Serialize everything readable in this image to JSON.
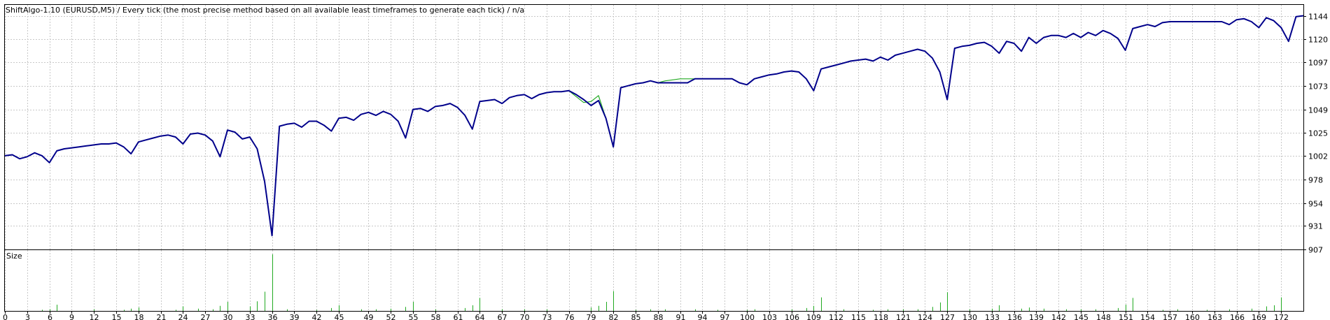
{
  "report_title": "ShiftAlgo-1.10 (EURUSD,M5) / Every tick (the most precise method based on all available least timeframes to generate each tick) / n/a",
  "volume_panel_label": "Size",
  "colors": {
    "balance_line": "#00008b",
    "equity_line": "#22aa22",
    "volume_bars": "#22aa22",
    "grid": "#c8c8c8",
    "frame": "#000000"
  },
  "chart_data": {
    "type": "line",
    "title": "ShiftAlgo-1.10 (EURUSD,M5) / Every tick (the most precise method based on all available least timeframes to generate each tick) / n/a",
    "xlabel": "",
    "ylabel": "",
    "xlim": [
      0,
      175
    ],
    "ylim": [
      907,
      1155
    ],
    "x_ticks": [
      0,
      3,
      6,
      9,
      12,
      15,
      18,
      21,
      24,
      27,
      30,
      33,
      36,
      39,
      42,
      45,
      49,
      52,
      55,
      58,
      61,
      64,
      67,
      70,
      73,
      76,
      79,
      82,
      85,
      88,
      91,
      94,
      97,
      100,
      103,
      106,
      109,
      112,
      115,
      118,
      121,
      124,
      127,
      130,
      133,
      136,
      139,
      142,
      145,
      148,
      151,
      154,
      157,
      160,
      163,
      166,
      169,
      172
    ],
    "y_ticks": [
      907,
      931,
      954,
      978,
      1002,
      1025,
      1049,
      1073,
      1097,
      1120,
      1144
    ],
    "grid": true,
    "series": [
      {
        "name": "",
        "color": "#00008b",
        "points": [
          [
            0,
            1002
          ],
          [
            1,
            1003
          ],
          [
            2,
            999
          ],
          [
            3,
            1001
          ],
          [
            4,
            1005
          ],
          [
            5,
            1002
          ],
          [
            6,
            995
          ],
          [
            7,
            1007
          ],
          [
            8,
            1009
          ],
          [
            9,
            1010
          ],
          [
            10,
            1011
          ],
          [
            11,
            1012
          ],
          [
            12,
            1013
          ],
          [
            13,
            1014
          ],
          [
            14,
            1014
          ],
          [
            15,
            1015
          ],
          [
            16,
            1011
          ],
          [
            17,
            1004
          ],
          [
            18,
            1016
          ],
          [
            19,
            1018
          ],
          [
            20,
            1020
          ],
          [
            21,
            1022
          ],
          [
            22,
            1023
          ],
          [
            23,
            1021
          ],
          [
            24,
            1014
          ],
          [
            25,
            1024
          ],
          [
            26,
            1025
          ],
          [
            27,
            1023
          ],
          [
            28,
            1017
          ],
          [
            29,
            1001
          ],
          [
            30,
            1028
          ],
          [
            31,
            1026
          ],
          [
            32,
            1019
          ],
          [
            33,
            1021
          ],
          [
            34,
            1009
          ],
          [
            35,
            976
          ],
          [
            36,
            921
          ],
          [
            37,
            1032
          ],
          [
            38,
            1034
          ],
          [
            39,
            1035
          ],
          [
            40,
            1031
          ],
          [
            41,
            1037
          ],
          [
            42,
            1037
          ],
          [
            43,
            1033
          ],
          [
            44,
            1027
          ],
          [
            45,
            1040
          ],
          [
            46,
            1041
          ],
          [
            47,
            1038
          ],
          [
            48,
            1044
          ],
          [
            49,
            1046
          ],
          [
            50,
            1043
          ],
          [
            51,
            1047
          ],
          [
            52,
            1044
          ],
          [
            53,
            1037
          ],
          [
            54,
            1020
          ],
          [
            55,
            1049
          ],
          [
            56,
            1050
          ],
          [
            57,
            1047
          ],
          [
            58,
            1052
          ],
          [
            59,
            1053
          ],
          [
            60,
            1055
          ],
          [
            61,
            1051
          ],
          [
            62,
            1043
          ],
          [
            63,
            1029
          ],
          [
            64,
            1057
          ],
          [
            65,
            1058
          ],
          [
            66,
            1059
          ],
          [
            67,
            1055
          ],
          [
            68,
            1061
          ],
          [
            69,
            1063
          ],
          [
            70,
            1064
          ],
          [
            71,
            1060
          ],
          [
            72,
            1064
          ],
          [
            73,
            1066
          ],
          [
            74,
            1067
          ],
          [
            75,
            1067
          ],
          [
            76,
            1068
          ],
          [
            77,
            1064
          ],
          [
            78,
            1059
          ],
          [
            79,
            1053
          ],
          [
            80,
            1058
          ],
          [
            81,
            1040
          ],
          [
            82,
            1011
          ],
          [
            83,
            1071
          ],
          [
            84,
            1073
          ],
          [
            85,
            1075
          ],
          [
            86,
            1076
          ],
          [
            87,
            1078
          ],
          [
            88,
            1076
          ],
          [
            89,
            1076
          ],
          [
            90,
            1076
          ],
          [
            91,
            1076
          ],
          [
            92,
            1076
          ],
          [
            93,
            1080
          ],
          [
            94,
            1080
          ],
          [
            95,
            1080
          ],
          [
            96,
            1080
          ],
          [
            97,
            1080
          ],
          [
            98,
            1080
          ],
          [
            99,
            1076
          ],
          [
            100,
            1074
          ],
          [
            101,
            1080
          ],
          [
            102,
            1082
          ],
          [
            103,
            1084
          ],
          [
            104,
            1085
          ],
          [
            105,
            1087
          ],
          [
            106,
            1088
          ],
          [
            107,
            1087
          ],
          [
            108,
            1080
          ],
          [
            109,
            1068
          ],
          [
            110,
            1090
          ],
          [
            111,
            1092
          ],
          [
            112,
            1094
          ],
          [
            113,
            1096
          ],
          [
            114,
            1098
          ],
          [
            115,
            1099
          ],
          [
            116,
            1100
          ],
          [
            117,
            1098
          ],
          [
            118,
            1102
          ],
          [
            119,
            1099
          ],
          [
            120,
            1104
          ],
          [
            121,
            1106
          ],
          [
            122,
            1108
          ],
          [
            123,
            1110
          ],
          [
            124,
            1108
          ],
          [
            125,
            1101
          ],
          [
            126,
            1087
          ],
          [
            127,
            1059
          ],
          [
            128,
            1111
          ],
          [
            129,
            1113
          ],
          [
            130,
            1114
          ],
          [
            131,
            1116
          ],
          [
            132,
            1117
          ],
          [
            133,
            1113
          ],
          [
            134,
            1106
          ],
          [
            135,
            1118
          ],
          [
            136,
            1116
          ],
          [
            137,
            1108
          ],
          [
            138,
            1122
          ],
          [
            139,
            1116
          ],
          [
            140,
            1122
          ],
          [
            141,
            1124
          ],
          [
            142,
            1124
          ],
          [
            143,
            1122
          ],
          [
            144,
            1126
          ],
          [
            145,
            1122
          ],
          [
            146,
            1127
          ],
          [
            147,
            1124
          ],
          [
            148,
            1129
          ],
          [
            149,
            1126
          ],
          [
            150,
            1121
          ],
          [
            151,
            1109
          ],
          [
            152,
            1131
          ],
          [
            153,
            1133
          ],
          [
            154,
            1135
          ],
          [
            155,
            1133
          ],
          [
            156,
            1137
          ],
          [
            157,
            1138
          ],
          [
            158,
            1138
          ],
          [
            159,
            1138
          ],
          [
            160,
            1138
          ],
          [
            161,
            1138
          ],
          [
            162,
            1138
          ],
          [
            163,
            1138
          ],
          [
            164,
            1138
          ],
          [
            165,
            1135
          ],
          [
            166,
            1140
          ],
          [
            167,
            1141
          ],
          [
            168,
            1138
          ],
          [
            169,
            1132
          ],
          [
            170,
            1142
          ],
          [
            171,
            1139
          ],
          [
            172,
            1132
          ],
          [
            173,
            1118
          ],
          [
            174,
            1143
          ],
          [
            175,
            1144
          ]
        ]
      },
      {
        "name": "",
        "color": "#22aa22",
        "points": [
          [
            76,
            1068
          ],
          [
            77,
            1062
          ],
          [
            78,
            1056
          ],
          [
            79,
            1057
          ],
          [
            80,
            1063
          ],
          [
            81,
            1040
          ],
          [
            88,
            1076
          ],
          [
            89,
            1078
          ],
          [
            90,
            1079
          ],
          [
            91,
            1080
          ],
          [
            92,
            1080
          ],
          [
            93,
            1080
          ]
        ]
      }
    ],
    "volume": {
      "label": "Size",
      "color": "#22aa22",
      "ylim": [
        0,
        1
      ],
      "bars": [
        [
          5,
          0.02
        ],
        [
          6,
          0.03
        ],
        [
          7,
          0.11
        ],
        [
          12,
          0.03
        ],
        [
          16,
          0.02
        ],
        [
          17,
          0.04
        ],
        [
          18,
          0.06
        ],
        [
          23,
          0.02
        ],
        [
          24,
          0.08
        ],
        [
          26,
          0.04
        ],
        [
          28,
          0.03
        ],
        [
          29,
          0.09
        ],
        [
          30,
          0.16
        ],
        [
          33,
          0.08
        ],
        [
          34,
          0.17
        ],
        [
          35,
          0.34
        ],
        [
          36,
          1.0
        ],
        [
          38,
          0.03
        ],
        [
          42,
          0.02
        ],
        [
          44,
          0.05
        ],
        [
          45,
          0.1
        ],
        [
          48,
          0.03
        ],
        [
          50,
          0.03
        ],
        [
          52,
          0.04
        ],
        [
          54,
          0.07
        ],
        [
          55,
          0.16
        ],
        [
          58,
          0.03
        ],
        [
          62,
          0.05
        ],
        [
          63,
          0.1
        ],
        [
          64,
          0.23
        ],
        [
          67,
          0.03
        ],
        [
          70,
          0.03
        ],
        [
          73,
          0.03
        ],
        [
          79,
          0.06
        ],
        [
          80,
          0.09
        ],
        [
          81,
          0.16
        ],
        [
          82,
          0.35
        ],
        [
          85,
          0.02
        ],
        [
          87,
          0.03
        ],
        [
          89,
          0.03
        ],
        [
          93,
          0.03
        ],
        [
          96,
          0.02
        ],
        [
          100,
          0.02
        ],
        [
          101,
          0.03
        ],
        [
          106,
          0.03
        ],
        [
          108,
          0.05
        ],
        [
          109,
          0.09
        ],
        [
          110,
          0.24
        ],
        [
          113,
          0.03
        ],
        [
          117,
          0.02
        ],
        [
          119,
          0.03
        ],
        [
          121,
          0.03
        ],
        [
          123,
          0.03
        ],
        [
          125,
          0.07
        ],
        [
          126,
          0.15
        ],
        [
          127,
          0.33
        ],
        [
          130,
          0.03
        ],
        [
          133,
          0.04
        ],
        [
          134,
          0.1
        ],
        [
          137,
          0.04
        ],
        [
          138,
          0.06
        ],
        [
          140,
          0.04
        ],
        [
          143,
          0.03
        ],
        [
          145,
          0.03
        ],
        [
          147,
          0.03
        ],
        [
          150,
          0.05
        ],
        [
          151,
          0.11
        ],
        [
          152,
          0.23
        ],
        [
          156,
          0.02
        ],
        [
          158,
          0.03
        ],
        [
          162,
          0.02
        ],
        [
          165,
          0.03
        ],
        [
          168,
          0.04
        ],
        [
          170,
          0.08
        ],
        [
          171,
          0.1
        ],
        [
          172,
          0.24
        ]
      ]
    }
  }
}
